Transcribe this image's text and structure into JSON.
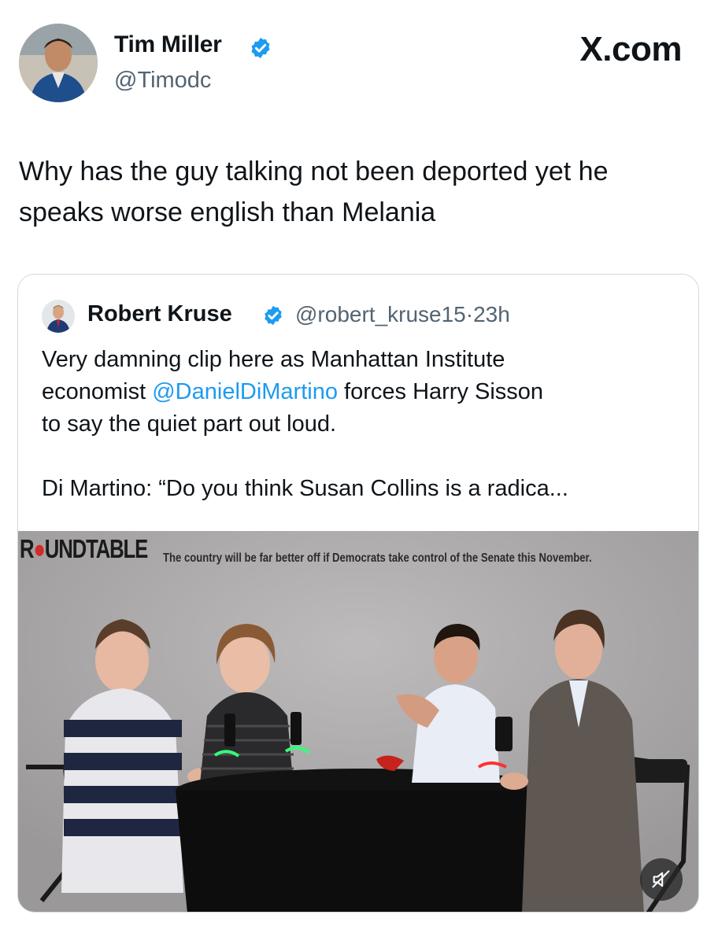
{
  "author": {
    "name": "Tim Miller",
    "handle": "@Timodc",
    "avatar_icon": "person-photo-avatar",
    "verified_icon": "verified-badge-icon"
  },
  "brand": "X.com",
  "tweet": {
    "lines": [
      "Why has the guy talking not been deported yet he",
      "speaks worse english than Melania"
    ]
  },
  "quote": {
    "name": "Robert Kruse",
    "handle": "@robert_kruse15",
    "separator": "·",
    "time": "23h",
    "line1": "Very damning clip here as Manhattan Institute",
    "line2_prefix": "economist ",
    "line2_mention": "@DanielDiMartino",
    "line2_suffix": " forces Harry Sisson",
    "line3": "to say the quiet part out loud.",
    "line4": "Di Martino: “Do you think Susan Collins is a radica..."
  },
  "media": {
    "logo_text": "R●UNDTABLE",
    "caption": "The country will be far better off if Democrats take control of the Senate this November.",
    "mute_icon": "muted-speaker-icon"
  },
  "colors": {
    "text": "#0f1419",
    "secondary": "#536471",
    "accent": "#1d9bf0",
    "border": "#cfd9de"
  }
}
